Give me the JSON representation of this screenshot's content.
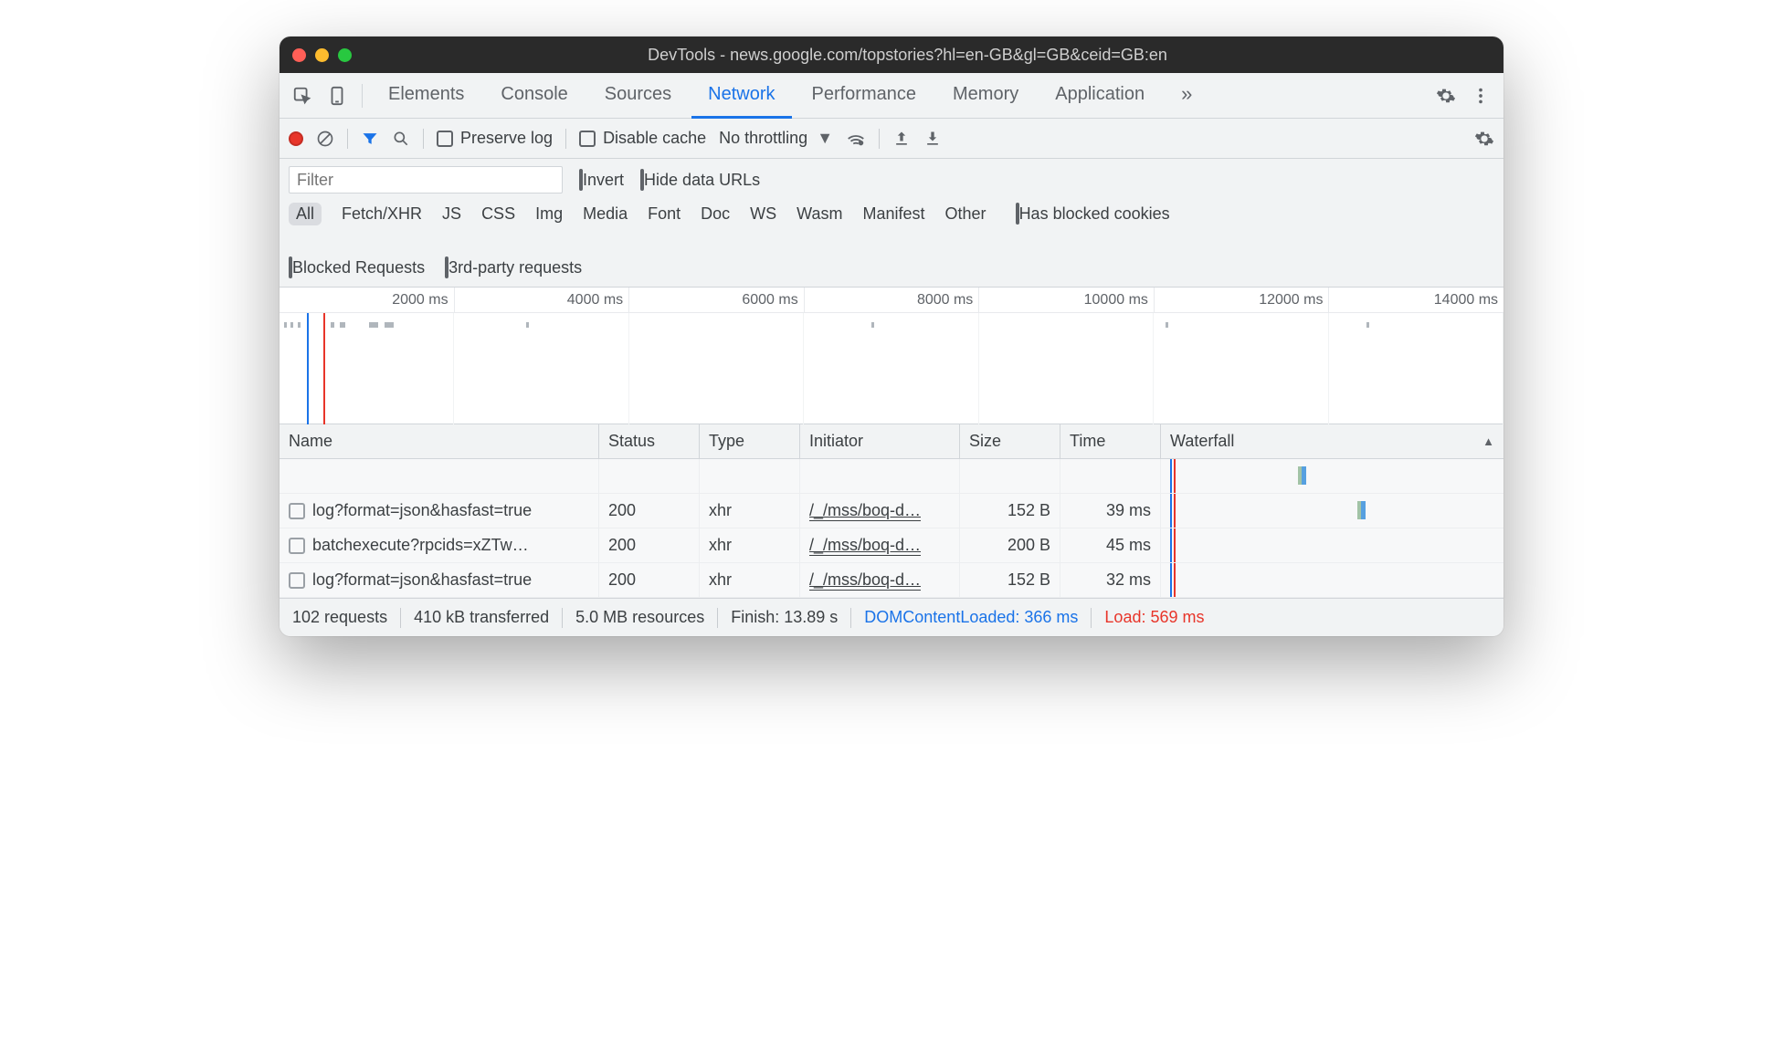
{
  "window": {
    "title": "DevTools - news.google.com/topstories?hl=en-GB&gl=GB&ceid=GB:en"
  },
  "tabs": {
    "items": [
      "Elements",
      "Console",
      "Sources",
      "Network",
      "Performance",
      "Memory",
      "Application"
    ],
    "active": "Network",
    "more": "»"
  },
  "toolbar": {
    "preserve_log": "Preserve log",
    "disable_cache": "Disable cache",
    "throttle": "No throttling"
  },
  "filter": {
    "placeholder": "Filter",
    "invert": "Invert",
    "hide_data_urls": "Hide data URLs",
    "types": [
      "All",
      "Fetch/XHR",
      "JS",
      "CSS",
      "Img",
      "Media",
      "Font",
      "Doc",
      "WS",
      "Wasm",
      "Manifest",
      "Other"
    ],
    "type_active": "All",
    "has_blocked_cookies": "Has blocked cookies",
    "blocked_requests": "Blocked Requests",
    "third_party": "3rd-party requests"
  },
  "timeline": {
    "ticks": [
      "2000 ms",
      "4000 ms",
      "6000 ms",
      "8000 ms",
      "10000 ms",
      "12000 ms",
      "14000 ms"
    ]
  },
  "table": {
    "headers": {
      "name": "Name",
      "status": "Status",
      "type": "Type",
      "initiator": "Initiator",
      "size": "Size",
      "time": "Time",
      "waterfall": "Waterfall"
    },
    "rows": [
      {
        "name": "log?format=json&hasfast=true",
        "status": "200",
        "type": "xhr",
        "initiator": "/_/mss/boq-d…",
        "size": "152 B",
        "time": "39 ms"
      },
      {
        "name": "batchexecute?rpcids=xZTw…",
        "status": "200",
        "type": "xhr",
        "initiator": "/_/mss/boq-d…",
        "size": "200 B",
        "time": "45 ms"
      },
      {
        "name": "log?format=json&hasfast=true",
        "status": "200",
        "type": "xhr",
        "initiator": "/_/mss/boq-d…",
        "size": "152 B",
        "time": "32 ms"
      }
    ]
  },
  "status": {
    "requests": "102 requests",
    "transferred": "410 kB transferred",
    "resources": "5.0 MB resources",
    "finish": "Finish: 13.89 s",
    "dcl": "DOMContentLoaded: 366 ms",
    "load": "Load: 569 ms"
  }
}
